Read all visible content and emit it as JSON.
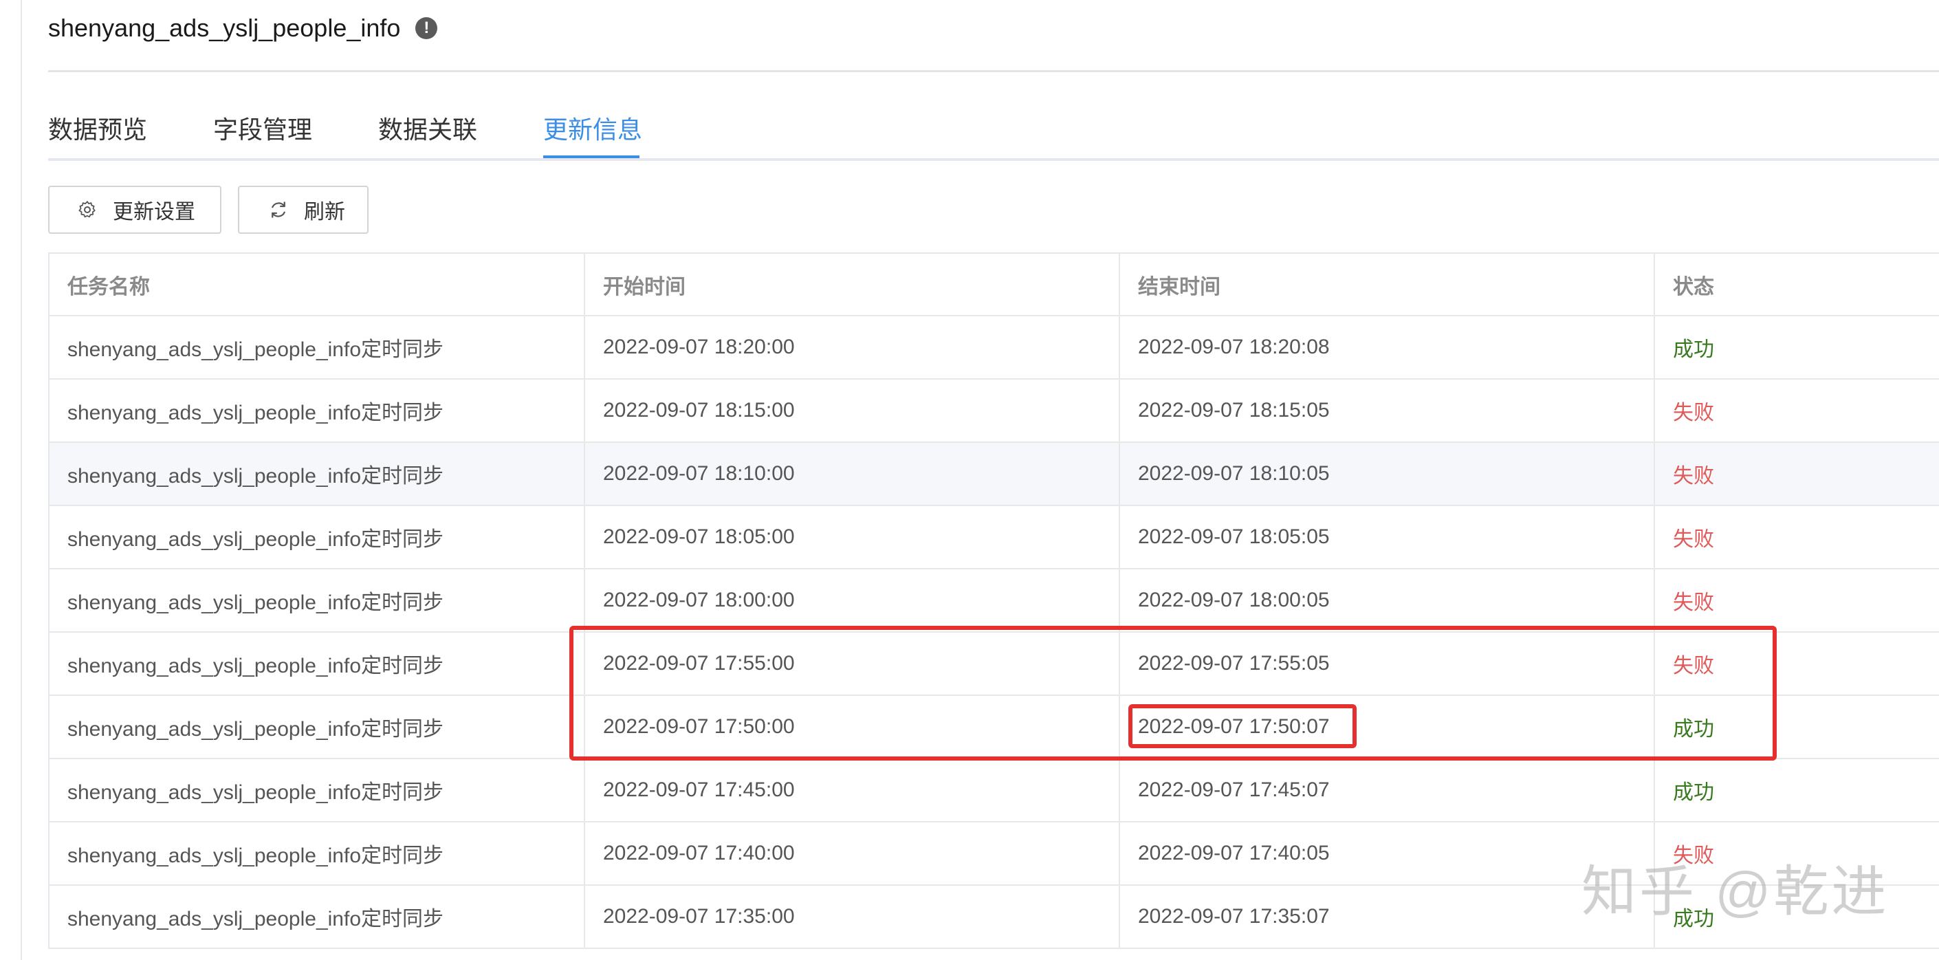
{
  "page": {
    "title": "shenyang_ads_yslj_people_info",
    "info_icon_glyph": "!"
  },
  "tabs": [
    {
      "label": "数据预览",
      "active": false
    },
    {
      "label": "字段管理",
      "active": false
    },
    {
      "label": "数据关联",
      "active": false
    },
    {
      "label": "更新信息",
      "active": true
    }
  ],
  "toolbar": {
    "settings_label": "更新设置",
    "settings_icon": "gear-icon",
    "refresh_label": "刷新",
    "refresh_icon": "refresh-icon"
  },
  "table": {
    "columns": [
      "任务名称",
      "开始时间",
      "结束时间",
      "状态"
    ],
    "rows": [
      {
        "task": "shenyang_ads_yslj_people_info定时同步",
        "start": "2022-09-07 18:20:00",
        "end": "2022-09-07 18:20:08",
        "status": "成功",
        "status_type": "success"
      },
      {
        "task": "shenyang_ads_yslj_people_info定时同步",
        "start": "2022-09-07 18:15:00",
        "end": "2022-09-07 18:15:05",
        "status": "失败",
        "status_type": "fail"
      },
      {
        "task": "shenyang_ads_yslj_people_info定时同步",
        "start": "2022-09-07 18:10:00",
        "end": "2022-09-07 18:10:05",
        "status": "失败",
        "status_type": "fail"
      },
      {
        "task": "shenyang_ads_yslj_people_info定时同步",
        "start": "2022-09-07 18:05:00",
        "end": "2022-09-07 18:05:05",
        "status": "失败",
        "status_type": "fail"
      },
      {
        "task": "shenyang_ads_yslj_people_info定时同步",
        "start": "2022-09-07 18:00:00",
        "end": "2022-09-07 18:00:05",
        "status": "失败",
        "status_type": "fail"
      },
      {
        "task": "shenyang_ads_yslj_people_info定时同步",
        "start": "2022-09-07 17:55:00",
        "end": "2022-09-07 17:55:05",
        "status": "失败",
        "status_type": "fail"
      },
      {
        "task": "shenyang_ads_yslj_people_info定时同步",
        "start": "2022-09-07 17:50:00",
        "end": "2022-09-07 17:50:07",
        "status": "成功",
        "status_type": "success"
      },
      {
        "task": "shenyang_ads_yslj_people_info定时同步",
        "start": "2022-09-07 17:45:00",
        "end": "2022-09-07 17:45:07",
        "status": "成功",
        "status_type": "success"
      },
      {
        "task": "shenyang_ads_yslj_people_info定时同步",
        "start": "2022-09-07 17:40:00",
        "end": "2022-09-07 17:40:05",
        "status": "失败",
        "status_type": "fail"
      },
      {
        "task": "shenyang_ads_yslj_people_info定时同步",
        "start": "2022-09-07 17:35:00",
        "end": "2022-09-07 17:35:07",
        "status": "成功",
        "status_type": "success"
      }
    ]
  },
  "colors": {
    "accent": "#3a8ee6",
    "success": "#3a7a1f",
    "fail": "#e05a5a",
    "annotation": "#e53030"
  },
  "watermark": "知乎 @乾进"
}
